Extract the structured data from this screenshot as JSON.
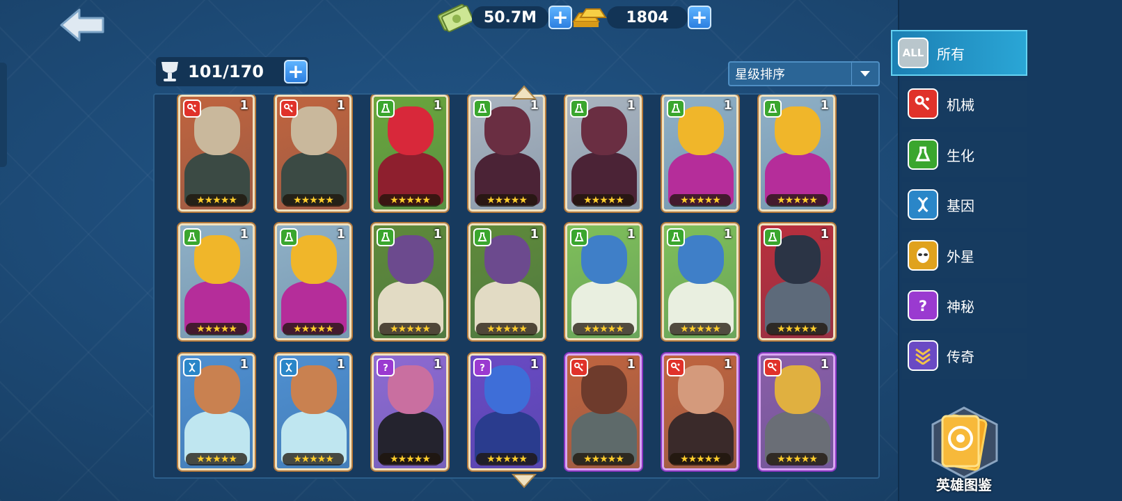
{
  "currency": {
    "cash": "50.7M",
    "gold": "1804"
  },
  "roster": {
    "capacity": "101/170"
  },
  "sort": {
    "label": "星级排序"
  },
  "cards": [
    {
      "faction": "mech",
      "level": "1",
      "stars": "★★★★★",
      "bg": "#c0643e",
      "skin": "#c9b89c",
      "body": "#3b4a44",
      "frame": "orange"
    },
    {
      "faction": "mech",
      "level": "1",
      "stars": "★★★★★",
      "bg": "#c0643e",
      "skin": "#c9b89c",
      "body": "#3b4a44",
      "frame": "orange"
    },
    {
      "faction": "bio",
      "level": "1",
      "stars": "★★★★★",
      "bg": "#6aa63c",
      "skin": "#d8283a",
      "body": "#8e1f2e",
      "frame": "orange"
    },
    {
      "faction": "bio",
      "level": "1",
      "stars": "★★★★★",
      "bg": "#a9b4c0",
      "skin": "#6a2e42",
      "body": "#4b2336",
      "frame": "orange"
    },
    {
      "faction": "bio",
      "level": "1",
      "stars": "★★★★★",
      "bg": "#a9b4c0",
      "skin": "#6a2e42",
      "body": "#4b2336",
      "frame": "orange"
    },
    {
      "faction": "bio",
      "level": "1",
      "stars": "★★★★★",
      "bg": "#8fb0c6",
      "skin": "#f0b62a",
      "body": "#b52d9a",
      "frame": "orange"
    },
    {
      "faction": "bio",
      "level": "1",
      "stars": "★★★★★",
      "bg": "#8fb0c6",
      "skin": "#f0b62a",
      "body": "#b52d9a",
      "frame": "orange"
    },
    {
      "faction": "bio",
      "level": "1",
      "stars": "★★★★★",
      "bg": "#8fb0c6",
      "skin": "#f0b62a",
      "body": "#b52d9a",
      "frame": "orange"
    },
    {
      "faction": "bio",
      "level": "1",
      "stars": "★★★★★",
      "bg": "#8fb0c6",
      "skin": "#f0b62a",
      "body": "#b52d9a",
      "frame": "orange"
    },
    {
      "faction": "bio",
      "level": "1",
      "stars": "★★★★★",
      "bg": "#5f8a3a",
      "skin": "#6c4a8e",
      "body": "#e2dbc4",
      "frame": "orange"
    },
    {
      "faction": "bio",
      "level": "1",
      "stars": "★★★★★",
      "bg": "#5f8a3a",
      "skin": "#6c4a8e",
      "body": "#e2dbc4",
      "frame": "orange"
    },
    {
      "faction": "bio",
      "level": "1",
      "stars": "★★★★★",
      "bg": "#7fbf5a",
      "skin": "#3f7fc8",
      "body": "#e9efe0",
      "frame": "orange"
    },
    {
      "faction": "bio",
      "level": "1",
      "stars": "★★★★★",
      "bg": "#7fbf5a",
      "skin": "#3f7fc8",
      "body": "#e9efe0",
      "frame": "orange"
    },
    {
      "faction": "bio",
      "level": "1",
      "stars": "★★★★★",
      "bg": "#b92f3d",
      "skin": "#2b3445",
      "body": "#5d6a7a",
      "frame": "orange"
    },
    {
      "faction": "gene",
      "level": "1",
      "stars": "★★★★★",
      "bg": "#4f8fd0",
      "skin": "#c98150",
      "body": "#bfe6f0",
      "frame": "orange"
    },
    {
      "faction": "gene",
      "level": "1",
      "stars": "★★★★★",
      "bg": "#4f8fd0",
      "skin": "#c98150",
      "body": "#bfe6f0",
      "frame": "orange"
    },
    {
      "faction": "mystic",
      "level": "1",
      "stars": "★★★★★",
      "bg": "#8e6ad2",
      "skin": "#c96fa0",
      "body": "#24232e",
      "frame": "orange"
    },
    {
      "faction": "mystic",
      "level": "1",
      "stars": "★★★★★",
      "bg": "#6a4ac4",
      "skin": "#3e6ed8",
      "body": "#2a3c8e",
      "frame": "orange"
    },
    {
      "faction": "mech",
      "level": "1",
      "stars": "★★★★★",
      "bg": "#c0643e",
      "skin": "#6e3b2c",
      "body": "#5e6a6a",
      "frame": "purple"
    },
    {
      "faction": "mech",
      "level": "1",
      "stars": "★★★★★",
      "bg": "#c0643e",
      "skin": "#d49a7c",
      "body": "#3a2a2a",
      "frame": "purple"
    },
    {
      "faction": "mech",
      "level": "1",
      "stars": "★★★★★",
      "bg": "#8a5ea8",
      "skin": "#e0b040",
      "body": "#6a6e76",
      "frame": "purple"
    }
  ],
  "categories": [
    {
      "key": "all",
      "icon_text": "ALL",
      "label": "所有",
      "color": "#b9c6cc",
      "icon": "all-icon"
    },
    {
      "key": "mech",
      "label": "机械",
      "color": "#e0322a",
      "icon": "mech-icon"
    },
    {
      "key": "bio",
      "label": "生化",
      "color": "#3aa62e",
      "icon": "flask-icon"
    },
    {
      "key": "gene",
      "label": "基因",
      "color": "#2a86c8",
      "icon": "dna-icon"
    },
    {
      "key": "alien",
      "label": "外星",
      "color": "#e0a21e",
      "icon": "alien-icon"
    },
    {
      "key": "mystic",
      "label": "神秘",
      "color": "#9a3ad0",
      "icon": "question-icon"
    },
    {
      "key": "legend",
      "label": "传奇",
      "color": "#6a4ac4",
      "icon": "chevron-rank-icon"
    }
  ],
  "codex": {
    "label": "英雄图鉴"
  }
}
